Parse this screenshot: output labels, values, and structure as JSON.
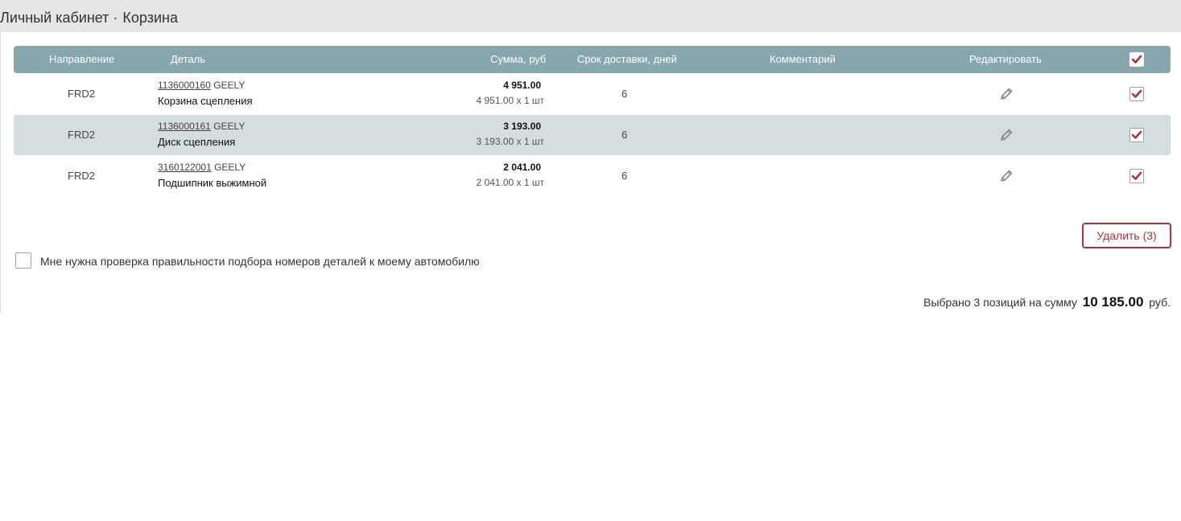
{
  "breadcrumb": {
    "root": "Личный кабинет",
    "separator": "·",
    "current": "Корзина"
  },
  "table": {
    "headers": {
      "direction": "Направление",
      "part": "Деталь",
      "sum": "Сумма, руб",
      "delivery": "Срок доставки, дней",
      "comment": "Комментарий",
      "edit": "Редактировать"
    },
    "select_all_checked": true,
    "rows": [
      {
        "direction": "FRD2",
        "part_number": "1136000160",
        "brand": "GEELY",
        "name": "Корзина сцепления",
        "sum": "4 951.00",
        "sum_detail": "4 951.00 x 1 шт",
        "days": "6",
        "checked": true
      },
      {
        "direction": "FRD2",
        "part_number": "1136000161",
        "brand": "GEELY",
        "name": "Диск сцепления",
        "sum": "3 193.00",
        "sum_detail": "3 193.00 x 1 шт",
        "days": "6",
        "checked": true
      },
      {
        "direction": "FRD2",
        "part_number": "3160122001",
        "brand": "GEELY",
        "name": "Подшипник выжимной",
        "sum": "2 041.00",
        "sum_detail": "2 041.00 x 1 шт",
        "days": "6",
        "checked": true
      }
    ]
  },
  "delete_button": "Удалить (3)",
  "check_option": {
    "label": "Мне нужна проверка правильности подбора номеров деталей к моему автомобилю",
    "checked": false
  },
  "summary": {
    "prefix": "Выбрано 3 позиций на сумму",
    "amount": "10 185.00",
    "suffix": "руб."
  },
  "colors": {
    "header_bg": "#87a7ad",
    "alt_row_bg": "#d5dde0",
    "accent": "#b0313b"
  },
  "icons": {
    "edit": "pencil-icon",
    "check": "checkmark-icon"
  }
}
